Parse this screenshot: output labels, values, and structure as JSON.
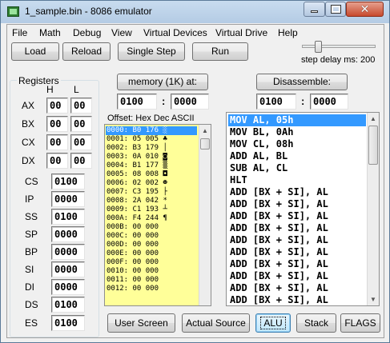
{
  "window": {
    "title": "1_sample.bin - 8086 emulator",
    "minimize_icon": "minimize-icon",
    "maximize_icon": "maximize-icon",
    "close_icon": "close-icon"
  },
  "menu": [
    "File",
    "Math",
    "Debug",
    "View",
    "Virtual Devices",
    "Virtual Drive",
    "Help"
  ],
  "toolbar": {
    "load": "Load",
    "reload": "Reload",
    "single_step": "Single Step",
    "run": "Run",
    "step_delay_label": "step delay ms: 200"
  },
  "registers": {
    "title": "Registers",
    "col_h": "H",
    "col_l": "L",
    "general": [
      {
        "name": "AX",
        "h": "00",
        "l": "00"
      },
      {
        "name": "BX",
        "h": "00",
        "l": "00"
      },
      {
        "name": "CX",
        "h": "00",
        "l": "00"
      },
      {
        "name": "DX",
        "h": "00",
        "l": "00"
      }
    ],
    "segment": [
      {
        "name": "CS",
        "value": "0100"
      },
      {
        "name": "IP",
        "value": "0000"
      },
      {
        "name": "SS",
        "value": "0100"
      },
      {
        "name": "SP",
        "value": "0000"
      },
      {
        "name": "BP",
        "value": "0000"
      },
      {
        "name": "SI",
        "value": "0000"
      },
      {
        "name": "DI",
        "value": "0000"
      },
      {
        "name": "DS",
        "value": "0100"
      },
      {
        "name": "ES",
        "value": "0100"
      }
    ]
  },
  "memory": {
    "button": "memory (1K) at:",
    "segment": "0100",
    "offset": "0000",
    "header": "Offset:   Hex  Dec ASCII",
    "lines": [
      "0000: B0 176 ░",
      "0001: 05 005 ♣",
      "0002: B3 179 │",
      "0003: 0A 010 ◙",
      "0004: B1 177 ▒",
      "0005: 08 008 ◘",
      "0006: 02 002 ☻",
      "0007: C3 195 ├",
      "0008: 2A 042 *",
      "0009: C1 193 ┴",
      "000A: F4 244 ¶",
      "000B: 00 000",
      "000C: 00 000",
      "000D: 00 000",
      "000E: 00 000",
      "000F: 00 000",
      "0010: 00 000",
      "0011: 00 000",
      "0012: 00 000"
    ]
  },
  "disassemble": {
    "button": "Disassemble:",
    "segment": "0100",
    "offset": "0000",
    "lines": [
      "MOV AL, 05h",
      "MOV BL, 0Ah",
      "MOV CL, 08h",
      "ADD AL, BL",
      "SUB AL, CL",
      "HLT",
      "ADD [BX + SI], AL",
      "ADD [BX + SI], AL",
      "ADD [BX + SI], AL",
      "ADD [BX + SI], AL",
      "ADD [BX + SI], AL",
      "ADD [BX + SI], AL",
      "ADD [BX + SI], AL",
      "ADD [BX + SI], AL",
      "ADD [BX + SI], AL",
      "ADD [BX + SI], AL"
    ]
  },
  "bottom_buttons": {
    "user_screen": "User Screen",
    "actual_source": "Actual Source",
    "alu": "ALU",
    "stack": "Stack",
    "flags": "FLAGS"
  },
  "colors": {
    "memory_bg": "#ffff99",
    "selection": "#3399ff"
  }
}
